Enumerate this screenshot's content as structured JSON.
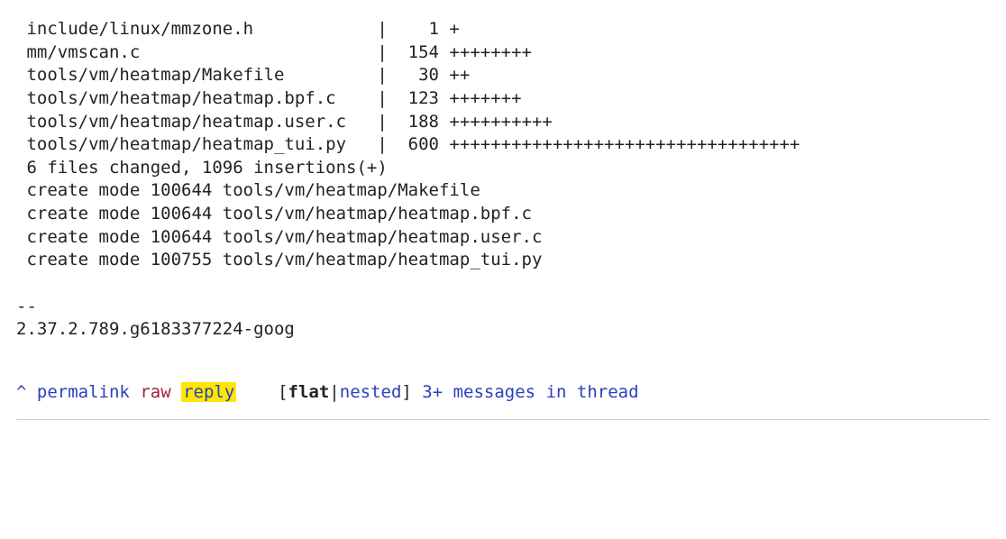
{
  "diffstat": {
    "files": [
      {
        "path": "include/linux/mmzone.h",
        "changes": 1,
        "plusbar": "+"
      },
      {
        "path": "mm/vmscan.c",
        "changes": 154,
        "plusbar": "++++++++"
      },
      {
        "path": "tools/vm/heatmap/Makefile",
        "changes": 30,
        "plusbar": "++"
      },
      {
        "path": "tools/vm/heatmap/heatmap.bpf.c",
        "changes": 123,
        "plusbar": "+++++++"
      },
      {
        "path": "tools/vm/heatmap/heatmap.user.c",
        "changes": 188,
        "plusbar": "++++++++++"
      },
      {
        "path": "tools/vm/heatmap/heatmap_tui.py",
        "changes": 600,
        "plusbar": "++++++++++++++++++++++++++++++++++"
      }
    ],
    "summary": "6 files changed, 1096 insertions(+)",
    "creates": [
      "create mode 100644 tools/vm/heatmap/Makefile",
      "create mode 100644 tools/vm/heatmap/heatmap.bpf.c",
      "create mode 100644 tools/vm/heatmap/heatmap.user.c",
      "create mode 100755 tools/vm/heatmap/heatmap_tui.py"
    ],
    "signature_sep": "--",
    "signature": "2.37.2.789.g6183377224-goog",
    "path_col_width": 33,
    "num_col_width": 4
  },
  "footer": {
    "caret": "^",
    "permalink": "permalink",
    "raw": "raw",
    "reply": "reply",
    "bracket_open": "[",
    "flat": "flat",
    "pipe": "|",
    "nested": "nested",
    "bracket_close": "]",
    "tail": "3+ messages in thread"
  }
}
